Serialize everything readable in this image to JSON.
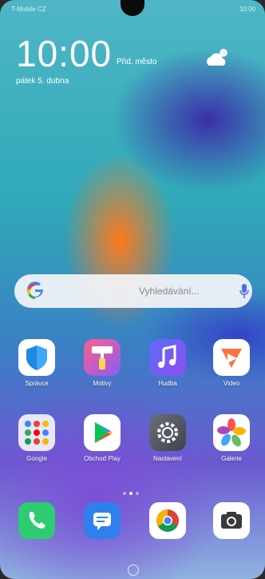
{
  "statusbar": {
    "carrier": "T-Mobile CZ",
    "time": "10:00"
  },
  "lockclock": {
    "time": "10:00",
    "city": "Přid. město",
    "date": "pátek 5. dubna"
  },
  "search": {
    "placeholder": "Vyhledávání..."
  },
  "apps_row1": [
    {
      "label": "Správce",
      "icon": "shield-icon"
    },
    {
      "label": "Motivy",
      "icon": "paint-roller-icon"
    },
    {
      "label": "Hudba",
      "icon": "music-note-icon"
    },
    {
      "label": "Video",
      "icon": "video-play-icon"
    }
  ],
  "apps_row2": [
    {
      "label": "Google",
      "icon": "google-folder-icon"
    },
    {
      "label": "Obchod Play",
      "icon": "play-store-icon"
    },
    {
      "label": "Nastavení",
      "icon": "settings-gear-icon"
    },
    {
      "label": "Galerie",
      "icon": "gallery-flower-icon"
    }
  ],
  "dock": [
    {
      "icon": "phone-icon"
    },
    {
      "icon": "messages-icon"
    },
    {
      "icon": "chrome-icon"
    },
    {
      "icon": "camera-icon"
    }
  ],
  "colors": {
    "accent": "#2fa9b8",
    "purple": "#3a2fa8",
    "orange": "#ff7a1a"
  }
}
